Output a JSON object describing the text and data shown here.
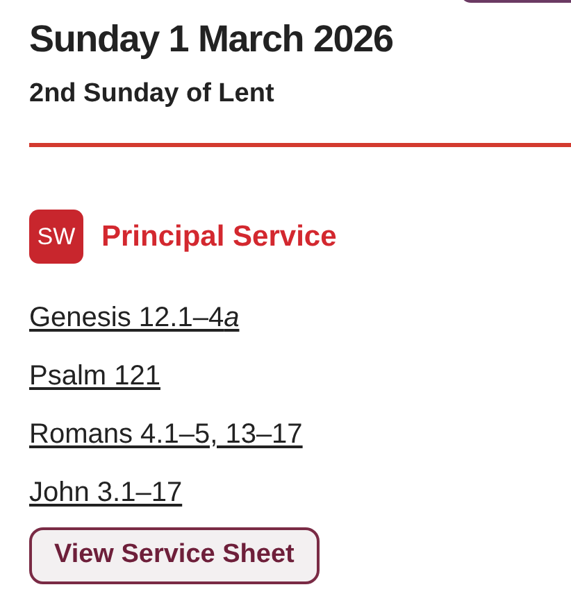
{
  "date_heading": "Sunday 1 March 2026",
  "occasion": "2nd Sunday of Lent",
  "service": {
    "badge": "SW",
    "title": "Principal Service"
  },
  "readings": [
    {
      "text": "Genesis 12.1–4",
      "italic_suffix": "a"
    },
    {
      "text": "Psalm 121"
    },
    {
      "text": "Romans 4.1–5, 13–17"
    },
    {
      "text": "John 3.1–17"
    }
  ],
  "button": "View Service Sheet"
}
